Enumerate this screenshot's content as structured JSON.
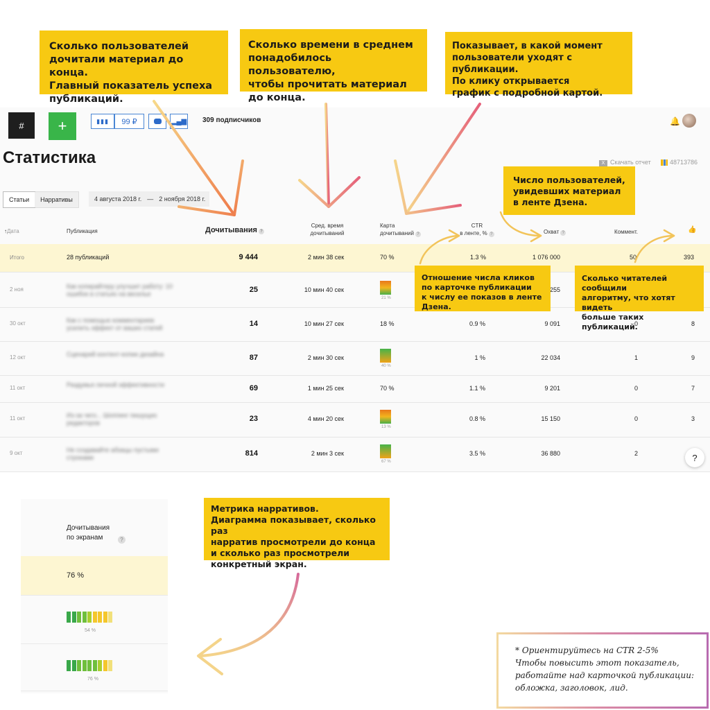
{
  "callouts": {
    "read_to_end": "Сколько пользователей\nдочитали материал до конца.\nГлавный показатель успеха\nпубликаций.",
    "avg_time": "Сколько времени в среднем\nпонадобилось пользователю,\nчтобы прочитать материал\nдо конца.",
    "map": "Показывает, в какой момент\nпользователи уходят с публикации.\nПо клику открывается\nграфик с подробной картой.",
    "reach": "Число пользователей,\nувидевших материал\nв ленте Дзена.",
    "ctr": "Отношение числа кликов\nпо карточке публикации\nк числу ее показов в ленте Дзена.",
    "likes": "Сколько читателей сообщили\nалгоритму, что хотят видеть\nбольше таких публикаций.",
    "narrative": "Метрика нарративов.\nДиаграмма показывает, сколько раз\nнарратив просмотрели до конца\nи сколько раз просмотрели\nконкретный экран."
  },
  "toolbar": {
    "hash_label": "#",
    "plus_label": "+",
    "balance": "99 ₽",
    "subscribers": "309 подписчиков"
  },
  "page": {
    "title": "Статистика",
    "download_report": "Скачать отчет",
    "channel_id": "48713786"
  },
  "tabs": {
    "articles": "Статьи",
    "narratives": "Нарративы"
  },
  "date_range": {
    "from": "4 августа 2018 г.",
    "sep": "—",
    "to": "2 ноября 2018 г."
  },
  "columns": {
    "date": "Дата",
    "publication": "Публикация",
    "reads": "Дочитывания",
    "avg_time_1": "Сред. время",
    "avg_time_2": "дочитываний",
    "map_1": "Карта",
    "map_2": "дочитываний",
    "ctr_1": "CTR",
    "ctr_2": "в ленте, %",
    "reach": "Охват",
    "comments": "Коммент.",
    "likes_icon": "thumbs-up-icon"
  },
  "total": {
    "label": "Итого",
    "publications": "28 публикаций",
    "reads": "9 444",
    "avg_time": "2 мин 38 сек",
    "map": "70 %",
    "ctr": "1.3 %",
    "reach": "1 076 000",
    "comments": "50",
    "likes": "393"
  },
  "rows": [
    {
      "date": "2 ноя",
      "title_a": "Как копирайтеру улучшит работу: 10",
      "title_b": "ошибок в статьях на веселье",
      "reads": "25",
      "avg_time": "10 мин 40 сек",
      "map": "21 %",
      "map_kind": "chart-red",
      "ctr": "",
      "reach": "255",
      "comments": "",
      "likes": ""
    },
    {
      "date": "30 окт",
      "title_a": "Как с помощью комментариев",
      "title_b": "усилить эффект от ваших статей",
      "reads": "14",
      "avg_time": "10 мин 27 сек",
      "map": "18 %",
      "map_kind": "text",
      "ctr": "0.9 %",
      "reach": "9 091",
      "comments": "0",
      "likes": "8"
    },
    {
      "date": "12 окт",
      "title_a": "Сценарий контент-копии дизайна",
      "title_b": "",
      "reads": "87",
      "avg_time": "2 мин 30 сек",
      "map": "40 %",
      "map_kind": "chart",
      "ctr": "1 %",
      "reach": "22 034",
      "comments": "1",
      "likes": "9"
    },
    {
      "date": "11 окт",
      "title_a": "Раздумья личной эффективности",
      "title_b": "",
      "reads": "69",
      "avg_time": "1 мин 25 сек",
      "map": "70 %",
      "map_kind": "text",
      "ctr": "1.1 %",
      "reach": "9 201",
      "comments": "0",
      "likes": "7"
    },
    {
      "date": "11 окт",
      "title_a": "Из-за чего... Шоппинг пишущих",
      "title_b": "редакторов",
      "reads": "23",
      "avg_time": "4 мин 20 сек",
      "map": "13 %",
      "map_kind": "chart-red",
      "ctr": "0.8 %",
      "reach": "15 150",
      "comments": "0",
      "likes": "3"
    },
    {
      "date": "9 окт",
      "title_a": "Не создавайте абзацы пустыми",
      "title_b": "строками",
      "reads": "814",
      "avg_time": "2 мин 3 сек",
      "map": "67 %",
      "map_kind": "chart",
      "ctr": "3.5 %",
      "reach": "36 880",
      "comments": "2",
      "likes": ""
    }
  ],
  "narrative_panel": {
    "heading": "Дочитывания\nпо экранам",
    "total": "76 %",
    "rows": [
      {
        "label": "54 %",
        "filled": 5,
        "total": 9
      },
      {
        "label": "76 %",
        "filled": 7,
        "total": 9
      }
    ]
  },
  "note": "* Ориентируйтесь на CTR 2-5%\nЧтобы повысить этот показатель,\nработайте над карточкой публикации:\nобложка, заголовок, лид.",
  "help": "?"
}
